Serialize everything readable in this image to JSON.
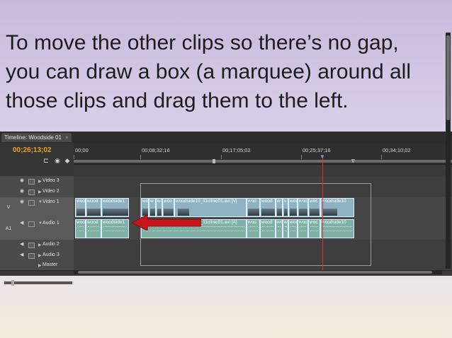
{
  "slide": {
    "lines": [
      "To move the other clips so there’s no gap,",
      "you can draw a box (a marquee) around all",
      "those clips and drag them to the left."
    ]
  },
  "timeline": {
    "tab_title": "Timeline: Woodside 01",
    "tab_close": "×",
    "menu_icon": "≡",
    "timecode": "00;26;13;02",
    "ruler_labels": [
      "00;00",
      "00;08;32;16",
      "00;17;05;02",
      "00;25;37;16",
      "00;34;10;02"
    ],
    "ruler_marker": "∇",
    "tracks": {
      "video3": "Video 3",
      "video2": "Video 2",
      "video1": "Video 1",
      "audio1": "Audio 1",
      "audio2": "Audio 2",
      "audio3": "Audio 3",
      "master": "Master"
    },
    "targets": {
      "video": "V",
      "audio": "A1"
    },
    "clips_video_left": [
      "woo",
      "wood",
      "woodside1"
    ],
    "clips_audio_left": [
      "woo",
      "wood",
      "woodside1"
    ],
    "clips_video_right": [
      "wo",
      "w",
      "w",
      "woo",
      "woodside10_11clinic01.avi [V]",
      "woo",
      "wood",
      "w",
      "v",
      "woc",
      "woc",
      "woc",
      "woodside10"
    ],
    "clips_audio_right": [
      "woo",
      "wood",
      "wo",
      "w",
      "woc",
      "woc",
      "woc",
      "woodside10"
    ],
    "audio_long_clip": "woodside10_11clinic01.avi [A]"
  },
  "colors": {
    "arrow": "#c8161d",
    "playhead": "#e03030",
    "timecode": "#e8a31e"
  }
}
